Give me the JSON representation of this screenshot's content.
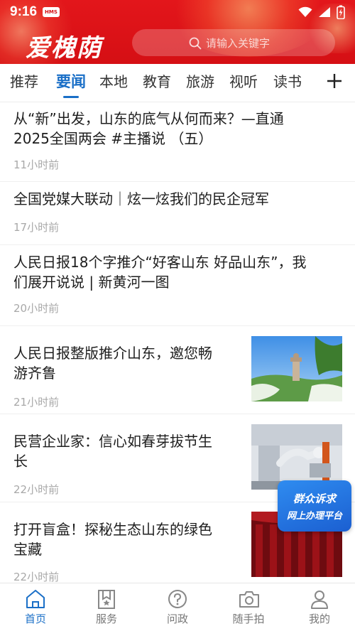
{
  "status_bar": {
    "time": "9:16",
    "badge": "HMS"
  },
  "header": {
    "logo": "爱槐荫",
    "search_placeholder": "请输入关键字"
  },
  "tabs": [
    {
      "label": "推荐",
      "active": false
    },
    {
      "label": "要闻",
      "active": true
    },
    {
      "label": "本地",
      "active": false
    },
    {
      "label": "教育",
      "active": false
    },
    {
      "label": "旅游",
      "active": false
    },
    {
      "label": "视听",
      "active": false
    },
    {
      "label": "读书",
      "active": false
    }
  ],
  "tab_add_icon": "plus-icon",
  "news": [
    {
      "title_line1": "从“新”出发，山东的底气从何而来？—直通",
      "title_line2": "2025全国两会  #主播说  （五）",
      "time": "11小时前",
      "thumbnail": ""
    },
    {
      "title_line1": "全国党媒大联动｜炫一炫我们的民企冠军",
      "title_line2": "",
      "time": "17小时前",
      "thumbnail": ""
    },
    {
      "title_line1": "人民日报18个字推介“好客山东  好品山东”，我",
      "title_line2": "们展开说说  |  新黄河一图",
      "time": "20小时前",
      "thumbnail": ""
    },
    {
      "title_line1": "人民日报整版推介山东，邀您畅",
      "title_line2": "游齐鲁",
      "time": "21小时前",
      "thumbnail": "landscape-photo"
    },
    {
      "title_line1": "民营企业家：信心如春芽拔节生",
      "title_line2": "长",
      "time": "22小时前",
      "thumbnail": "factory-photo"
    },
    {
      "title_line1": "打开盲盒！探秘生态山东的绿色",
      "title_line2": "宝藏",
      "time": "22小时前",
      "thumbnail": "stage-photo"
    }
  ],
  "float_badge": {
    "line1": "群众诉求",
    "line2": "网上办理平台"
  },
  "bottom_nav": [
    {
      "label": "首页",
      "icon": "home-icon",
      "active": true
    },
    {
      "label": "服务",
      "icon": "service-bookmark-icon",
      "active": false
    },
    {
      "label": "问政",
      "icon": "question-icon",
      "active": false
    },
    {
      "label": "随手拍",
      "icon": "camera-icon",
      "active": false
    },
    {
      "label": "我的",
      "icon": "user-icon",
      "active": false
    }
  ],
  "colors": {
    "header_red": "#d50f14",
    "accent_blue": "#1a6fc7",
    "time_gray": "#a8a8a8"
  }
}
